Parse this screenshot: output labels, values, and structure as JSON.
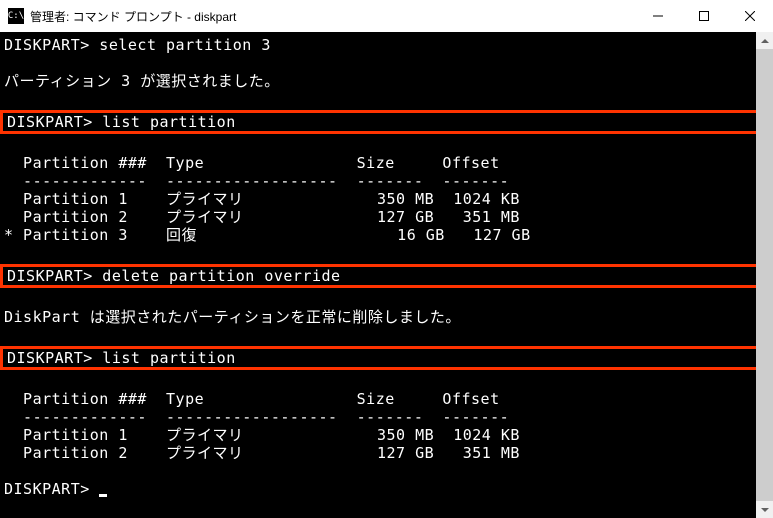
{
  "title": "管理者: コマンド プロンプト - diskpart",
  "lines": {
    "prompt1": "DISKPART> select partition 3",
    "msg1": "パーティション 3 が選択されました。",
    "prompt2": "DISKPART> list partition",
    "header1": "  Partition ###  Type                Size     Offset",
    "divider1": "  -------------  ------------------  -------  -------",
    "p1_1": "  Partition 1    プライマリ              350 MB  1024 KB",
    "p1_2": "  Partition 2    プライマリ              127 GB   351 MB",
    "p1_3": "* Partition 3    回復                     16 GB   127 GB",
    "prompt3": "DISKPART> delete partition override",
    "msg2": "DiskPart は選択されたパーティションを正常に削除しました。",
    "prompt4": "DISKPART> list partition",
    "header2": "  Partition ###  Type                Size     Offset",
    "divider2": "  -------------  ------------------  -------  -------",
    "p2_1": "  Partition 1    プライマリ              350 MB  1024 KB",
    "p2_2": "  Partition 2    プライマリ              127 GB   351 MB",
    "prompt5": "DISKPART> "
  }
}
